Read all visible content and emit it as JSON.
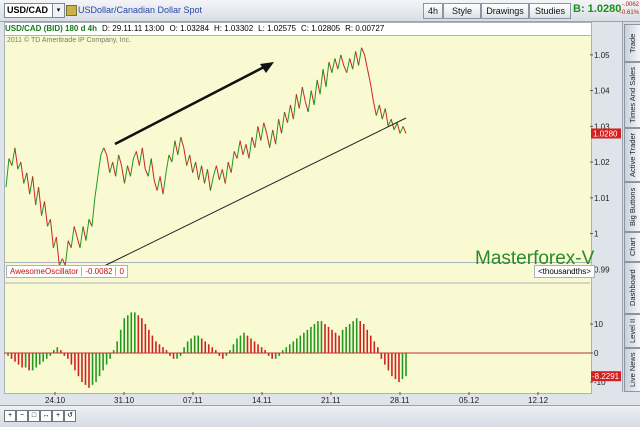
{
  "topbar": {
    "symbol": "USD/CAD",
    "instrument_name": "USDollar/Canadian Dollar Spot",
    "buttons": [
      {
        "label": "4h",
        "name": "timeframe-button"
      },
      {
        "label": "Style",
        "name": "style-button"
      },
      {
        "label": "Drawings",
        "name": "drawings-button"
      },
      {
        "label": "Studies",
        "name": "studies-button"
      }
    ],
    "price_label": "B: 1.0280",
    "change_abs": "-.0062",
    "change_pct": "-0.61%"
  },
  "infobar": {
    "title": "USD/CAD (BID) 180 d 4h",
    "date": "D: 29.11.11 13:00",
    "open": "O: 1.03284",
    "high": "H: 1.03302",
    "low": "L: 1.02575",
    "close": "C: 1.02805",
    "range": "R: 0.00727"
  },
  "copyright": "2011 © TD Ameritrade IP Company, Inc.",
  "watermark": "Masterforex-V",
  "oscillator": {
    "name": "AwesomeOscillator",
    "value": "-0.0082",
    "param": "0",
    "units": "<thousandths>"
  },
  "sidebar_tabs": [
    "Trade",
    "Times And Sales",
    "Active Trader",
    "Big Buttons",
    "Chart",
    "Dashboard",
    "Level II",
    "Live News"
  ],
  "colors": {
    "up": "#1f9a1f",
    "down": "#d02020",
    "accent": "#1b8f1b"
  },
  "chart_data": [
    {
      "type": "line",
      "name": "price",
      "x_tick_labels": [
        "24.10",
        "31.10",
        "07.11",
        "14.11",
        "21.11",
        "28.11",
        "05.12",
        "12.12"
      ],
      "y_tick_labels": [
        "1.05",
        "1.04",
        "1.03",
        "1.02",
        "1.01",
        "1",
        "0.99"
      ],
      "ylim": [
        0.987,
        1.055
      ],
      "last_price_label": "1.0280",
      "x": [
        0,
        2,
        4,
        6,
        8,
        10,
        12,
        14,
        16,
        18,
        20,
        22,
        24,
        26,
        28,
        30,
        32,
        34,
        36,
        38,
        40,
        42,
        44,
        46,
        48,
        50,
        52,
        54,
        56,
        58,
        60,
        62,
        64,
        66,
        68,
        70,
        72,
        74,
        76,
        78,
        80,
        82,
        84,
        86,
        88,
        90,
        92,
        94,
        96,
        98,
        100,
        102,
        104,
        106,
        108,
        110,
        112,
        114,
        116,
        118,
        120,
        122,
        124,
        126,
        128,
        130,
        132,
        134,
        136,
        138,
        140,
        142,
        144,
        146,
        148,
        150,
        152,
        154,
        156,
        158,
        160,
        162,
        164,
        166,
        168,
        170,
        172,
        174,
        176,
        178,
        180,
        182,
        184,
        186,
        188,
        190,
        192,
        194,
        196,
        198,
        200,
        202,
        204,
        206,
        208,
        210,
        212,
        214,
        216,
        218,
        220,
        222,
        224,
        226,
        228,
        230,
        232,
        234,
        236,
        238,
        240,
        242,
        244,
        246,
        248,
        250,
        252,
        254,
        256,
        258,
        260,
        262,
        264,
        266,
        268,
        270
      ],
      "values": [
        1.013,
        1.021,
        1.019,
        1.024,
        1.018,
        1.02,
        1.014,
        1.017,
        1.011,
        1.016,
        1.008,
        1.013,
        1.005,
        1.009,
        1.002,
        1.004,
        0.996,
        0.999,
        0.991,
        0.993,
        0.991,
        0.998,
        0.996,
        1.002,
        0.999,
        0.996,
        1.002,
        0.998,
        1.004,
        1.002,
        1.01,
        1.016,
        1.022,
        1.024,
        1.022,
        1.017,
        1.02,
        1.016,
        1.022,
        1.019,
        1.014,
        1.019,
        1.016,
        1.021,
        1.023,
        1.019,
        1.024,
        1.018,
        1.016,
        1.021,
        1.015,
        1.012,
        1.016,
        1.011,
        1.017,
        1.022,
        1.02,
        1.026,
        1.022,
        1.027,
        1.024,
        1.019,
        1.022,
        1.017,
        1.02,
        1.015,
        1.019,
        1.014,
        1.018,
        1.012,
        1.016,
        1.019,
        1.015,
        1.018,
        1.014,
        1.02,
        1.017,
        1.023,
        1.021,
        1.026,
        1.022,
        1.025,
        1.021,
        1.027,
        1.024,
        1.03,
        1.026,
        1.031,
        1.028,
        1.024,
        1.029,
        1.025,
        1.032,
        1.028,
        1.034,
        1.031,
        1.036,
        1.032,
        1.039,
        1.035,
        1.041,
        1.037,
        1.034,
        1.04,
        1.036,
        1.043,
        1.039,
        1.046,
        1.041,
        1.048,
        1.045,
        1.049,
        1.046,
        1.05,
        1.047,
        1.045,
        1.049,
        1.046,
        1.051,
        1.047,
        1.052,
        1.05,
        1.046,
        1.042,
        1.037,
        1.033,
        1.036,
        1.032,
        1.035,
        1.03,
        1.032,
        1.029,
        1.031,
        1.028,
        1.03,
        1.028
      ]
    },
    {
      "type": "bar",
      "name": "AwesomeOscillator",
      "y_tick_labels": [
        "10",
        "0",
        "-10"
      ],
      "ylim": [
        -13.5,
        14.5
      ],
      "last_value_label": "-8.2291",
      "values": [
        -1,
        -2,
        -3,
        -4,
        -5,
        -5,
        -6,
        -6,
        -5,
        -4,
        -3,
        -2,
        -1,
        1,
        2,
        1,
        -1,
        -2,
        -4,
        -6,
        -8,
        -10,
        -11,
        -12,
        -11,
        -10,
        -8,
        -6,
        -4,
        -2,
        1,
        4,
        8,
        12,
        13,
        14,
        14,
        13,
        12,
        10,
        8,
        6,
        4,
        3,
        2,
        1,
        -1,
        -2,
        -2,
        -1,
        2,
        4,
        5,
        6,
        6,
        5,
        4,
        3,
        2,
        1,
        -1,
        -2,
        -1,
        1,
        3,
        5,
        6,
        7,
        6,
        5,
        4,
        3,
        2,
        1,
        -1,
        -2,
        -2,
        -1,
        1,
        2,
        3,
        4,
        5,
        6,
        7,
        8,
        9,
        10,
        11,
        11,
        10,
        9,
        8,
        7,
        6,
        8,
        9,
        10,
        11,
        12,
        11,
        10,
        8,
        6,
        4,
        2,
        -2,
        -4,
        -6,
        -8,
        -9,
        -10,
        -9,
        -8
      ]
    }
  ]
}
